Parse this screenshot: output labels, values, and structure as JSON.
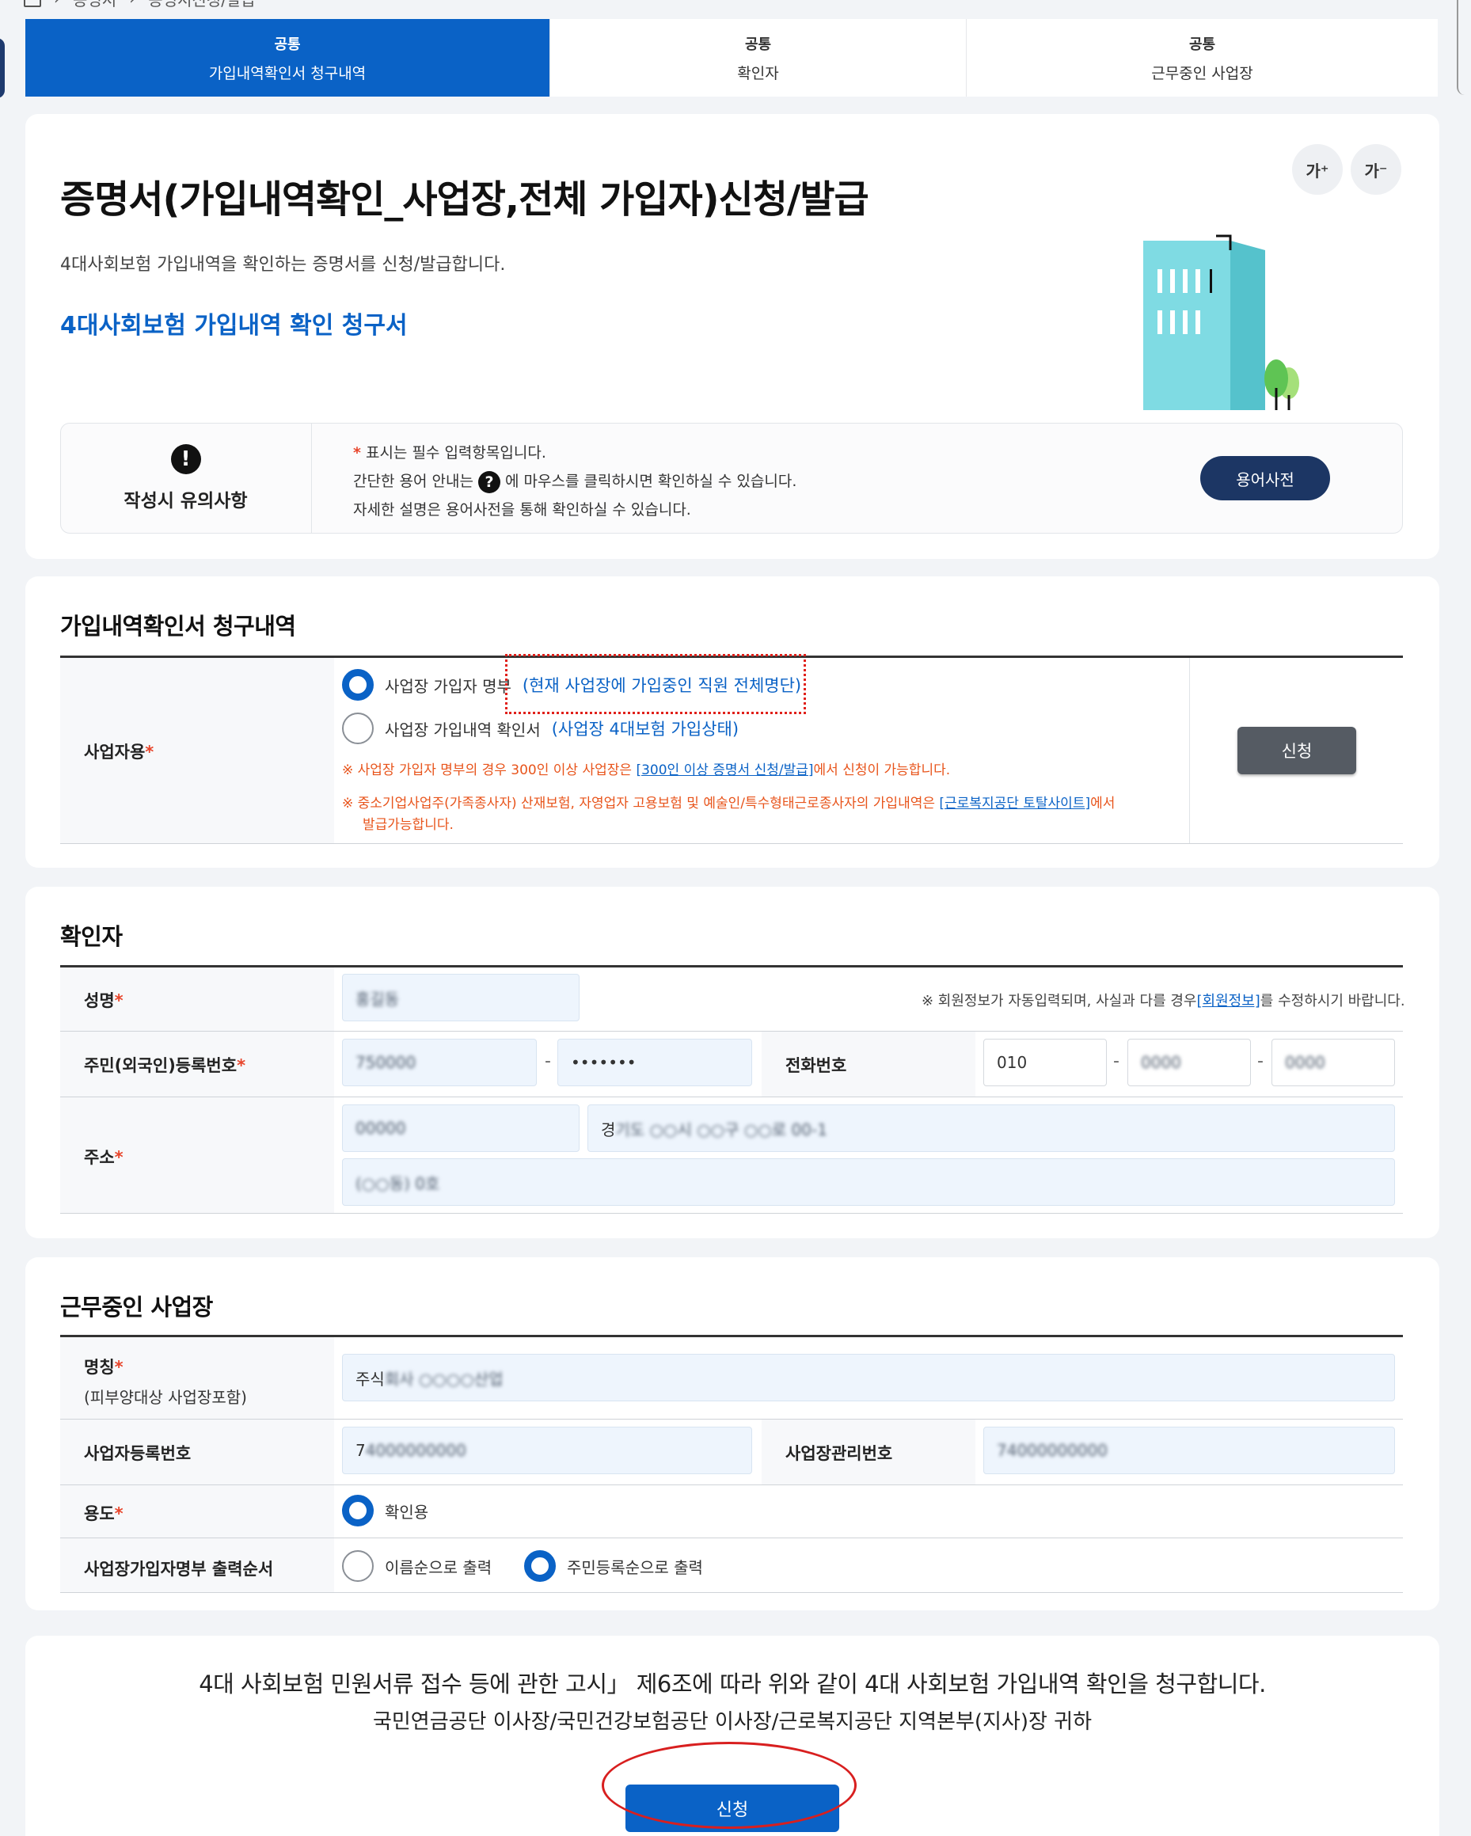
{
  "breadcrumb": {
    "items": [
      "증명서",
      "증명서신청/발급"
    ]
  },
  "steps": [
    {
      "head": "공통",
      "label": "가입내역확인서 청구내역"
    },
    {
      "head": "공통",
      "label": "확인자"
    },
    {
      "head": "공통",
      "label": "근무중인 사업장"
    }
  ],
  "header": {
    "title": "증명서(가입내역확인_사업장,전체 가입자)신청/발급",
    "description": "4대사회보험 가입내역을 확인하는 증명서를 신청/발급합니다.",
    "subtitle": "4대사회보험 가입내역 확인 청구서",
    "font_up": "가⁺",
    "font_down": "가⁻"
  },
  "notice": {
    "title": "작성시 유의사항",
    "line1_star": "*",
    "line1": " 표시는 필수 입력항목입니다.",
    "line2_pre": "간단한 용어 안내는 ",
    "line2_icon": "?",
    "line2_post": " 에 마우스를 클릭하시면 확인하실 수 있습니다.",
    "line3": "자세한 설명은 용어사전을 통해 확인하실 수 있습니다.",
    "dict_button": "용어사전"
  },
  "claim": {
    "section_title": "가입내역확인서 청구내역",
    "label": "사업자용",
    "required": "*",
    "option1_text": "사업장 가입자 명부",
    "option1_link": "(현재 사업장에 가입중인 직원 전체명단)",
    "option2_text": "사업장 가입내역 확인서",
    "option2_link": "(사업장 4대보험 가입상태)",
    "warn1_pre": "※ 사업장 가입자 명부의 경우 300인 이상 사업장은 ",
    "warn1_link": "[300인 이상 증명서 신청/발급]",
    "warn1_post": "에서 신청이 가능합니다.",
    "warn2_pre": "※ 중소기업사업주(가족종사자) 산재보험, 자영업자 고용보험 및 예술인/특수형태근로종사자의 가입내역은 ",
    "warn2_link": "[근로복지공단 토탈사이트]",
    "warn2_post": "에서",
    "warn2_line2": "발급가능합니다.",
    "apply_button": "신청",
    "selected_option": 1
  },
  "confirmer": {
    "section_title": "확인자",
    "name_label": "성명",
    "name_value": "홍길동",
    "notice_pre": "※ 회원정보가 자동입력되며, 사실과 다를 경우",
    "notice_link": "[회원정보]",
    "notice_post": "를 수정하시기 바랍니다.",
    "rrn_label": "주민(외국인)등록번호",
    "rrn_front": "750000",
    "rrn_back": "•••••••",
    "phone_label": "전화번호",
    "phone1": "010",
    "phone2": "0000",
    "phone3": "0000",
    "addr_label": "주소",
    "addr_zip": "00000",
    "addr_line1_prefix": "경",
    "addr_line1": "기도 ○○시 ○○구 ○○로 00-1",
    "addr_line2": "(○○동) 0호",
    "required": "*",
    "dash": "-"
  },
  "workplace": {
    "section_title": "근무중인 사업장",
    "name_label": "명칭",
    "name_sub": "(피부양대상 사업장포함)",
    "name_prefix": "주식",
    "name_value": "회사 ○○○○산업",
    "bizno_label": "사업자등록번호",
    "bizno_prefix": "7",
    "bizno_value": "4000000000",
    "mgmt_label": "사업장관리번호",
    "mgmt_value": "74000000000",
    "purpose_label": "용도",
    "purpose_value": "확인용",
    "order_label": "사업장가입자명부 출력순서",
    "order_opt1": "이름순으로 출력",
    "order_opt2": "주민등록순으로 출력",
    "order_selected": 2,
    "required": "*"
  },
  "declaration": {
    "line1": "4대 사회보험 민원서류 접수 등에 관한 고시」 제6조에 따라 위와 같이 4대 사회보험 가입내역 확인을 청구합니다.",
    "line2": "국민연금공단 이사장/국민건강보험공단 이사장/근로복지공단 지역본부(지사)장 귀하",
    "submit_button": "신청"
  },
  "colors": {
    "primary": "#0a62c6",
    "navy": "#1c3664",
    "warn": "#e8541b",
    "highlight": "#d81f1f"
  }
}
